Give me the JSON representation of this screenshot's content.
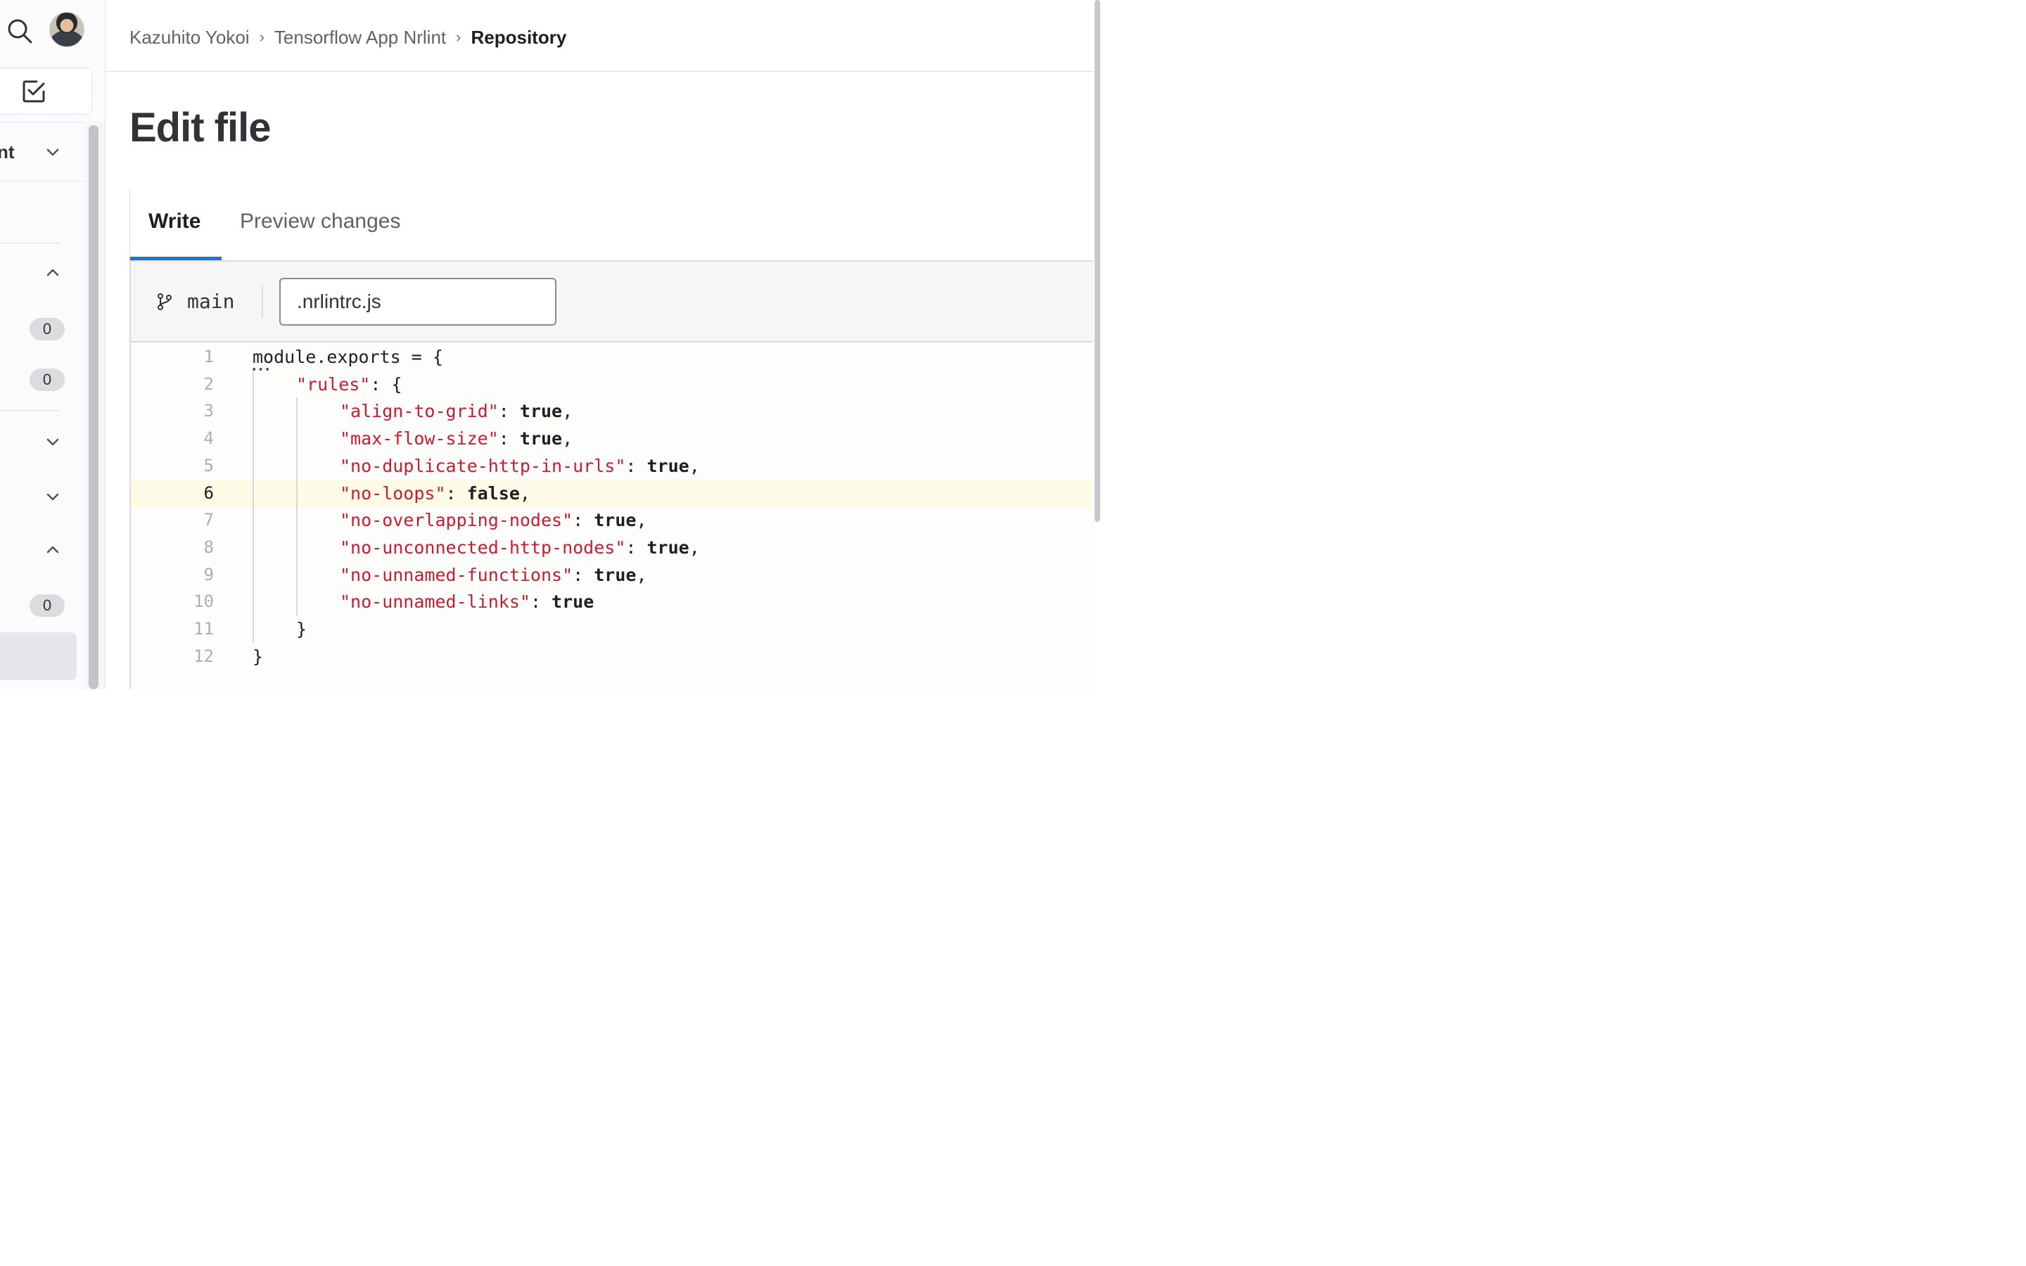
{
  "sidebar": {
    "top_group_text": "nt",
    "badges": [
      "0",
      "0",
      "0"
    ]
  },
  "breadcrumb": {
    "items": [
      "Kazuhito Yokoi",
      "Tensorflow App Nrlint",
      "Repository"
    ],
    "separator": "›"
  },
  "page": {
    "title": "Edit file"
  },
  "tabs": {
    "write": "Write",
    "preview": "Preview changes",
    "active": "Write"
  },
  "editor": {
    "branch": "main",
    "filename": ".nrlintrc.js",
    "current_line": 6,
    "line_numbers": [
      "1",
      "2",
      "3",
      "4",
      "5",
      "6",
      "7",
      "8",
      "9",
      "10",
      "11",
      "12"
    ],
    "lines": [
      {
        "plain": "module.exports = {"
      },
      {
        "str": "\"rules\"",
        "rest": ": {"
      },
      {
        "str": "\"align-to-grid\"",
        "punct": ": ",
        "kw": "true",
        "end": ","
      },
      {
        "str": "\"max-flow-size\"",
        "punct": ": ",
        "kw": "true",
        "end": ","
      },
      {
        "str": "\"no-duplicate-http-in-urls\"",
        "punct": ": ",
        "kw": "true",
        "end": ","
      },
      {
        "str": "\"no-loops\"",
        "punct": ": ",
        "kw": "false",
        "end": ","
      },
      {
        "str": "\"no-overlapping-nodes\"",
        "punct": ": ",
        "kw": "true",
        "end": ","
      },
      {
        "str": "\"no-unconnected-http-nodes\"",
        "punct": ": ",
        "kw": "true",
        "end": ","
      },
      {
        "str": "\"no-unnamed-functions\"",
        "punct": ": ",
        "kw": "true",
        "end": ","
      },
      {
        "str": "\"no-unnamed-links\"",
        "punct": ": ",
        "kw": "true",
        "end": ""
      },
      {
        "plain": "}"
      },
      {
        "plain": "}"
      }
    ]
  },
  "colors": {
    "accent": "#1f75cb",
    "string": "#c91c30",
    "current_line_bg": "#fdfbe6"
  }
}
